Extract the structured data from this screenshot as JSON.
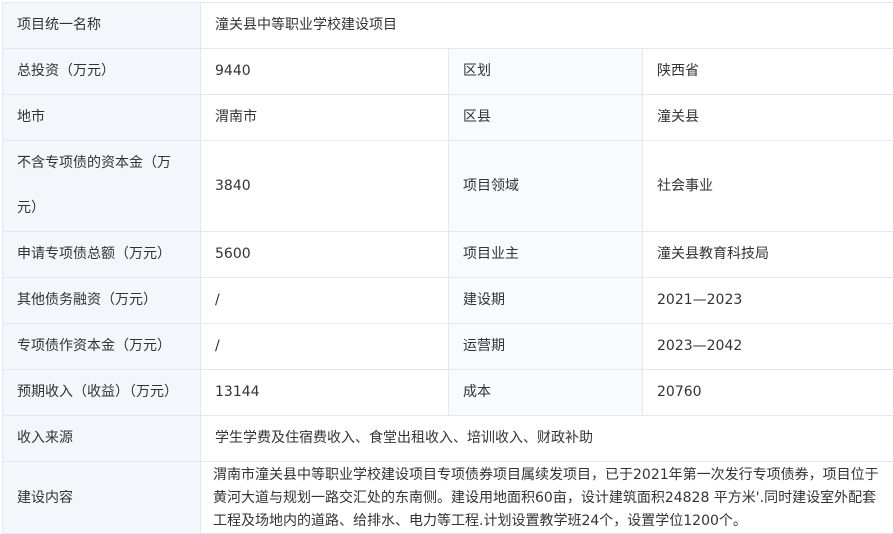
{
  "rows": [
    {
      "k1": "项目统一名称",
      "v1": "潼关县中等职业学校建设项目"
    },
    {
      "k1": "总投资（万元）",
      "v1": "9440",
      "k2": "区划",
      "v2": "陕西省"
    },
    {
      "k1": "地市",
      "v1": "渭南市",
      "k2": "区县",
      "v2": "潼关县"
    },
    {
      "k1": "不含专项债的资本金（万元）",
      "v1": "3840",
      "k2": "项目领域",
      "v2": "社会事业"
    },
    {
      "k1": "申请专项债总额（万元）",
      "v1": "5600",
      "k2": "项目业主",
      "v2": "潼关县教育科技局"
    },
    {
      "k1": "其他债务融资（万元）",
      "v1": "/",
      "k2": "建设期",
      "v2": "2021—2023"
    },
    {
      "k1": "专项债作资本金（万元）",
      "v1": "/",
      "k2": "运营期",
      "v2": "2023—2042"
    },
    {
      "k1": "预期收入（收益）（万元）",
      "v1": "13144",
      "k2": "成本",
      "v2": "20760"
    },
    {
      "k1": "收入来源",
      "v1": "学生学费及住宿费收入、食堂出租收入、培训收入、财政补助"
    },
    {
      "k1": "建设内容",
      "v1": "渭南市潼关县中等职业学校建设项目专项债券项目属续发项目，已于2021年第一次发行专项债券，项目位于黄河大道与规划一路交汇处的东南侧。建设用地面积60亩，设计建筑面积24828 平方米'.同时建设室外配套工程及场地内的道路、给排水、电力等工程.计划设置教学班24个，设置学位1200个。"
    }
  ]
}
